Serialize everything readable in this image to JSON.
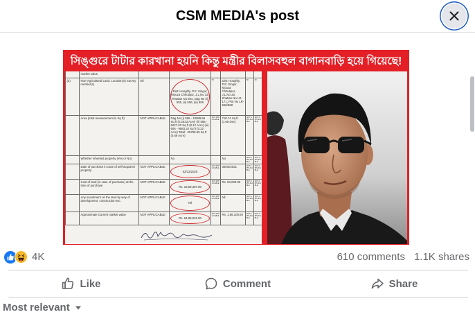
{
  "header": {
    "title": "CSM MEDIA's post"
  },
  "close_button": {
    "icon": "close-icon",
    "focus_ring_color": "#1a5bc4"
  },
  "post_image": {
    "headline": "সিঙ্গুরে টাটার কারখানা হয়নি কিন্তু মন্ত্রীর বিলাসবহুল বাগানবাড়ি হয়ে গিয়েছে!",
    "background_color": "#e41f26",
    "document": {
      "rows": [
        {
          "cells": [
            "",
            "market value",
            "",
            "",
            "",
            "",
            "",
            ""
          ]
        },
        {
          "cells": [
            "(a)",
            "Non-Agricultural Land: Location(s) Survey number(s)",
            "Nil",
            "Dist: Hooghly, P.S: Singur, Mouza Chhutipur, J.L.No 33, Khatian No 681, Dag No (i) 555, (ii) 556, (iii) 606",
            "Nil",
            "Dist: Hooghly, P.S: Singur, Mouza Chhutipur, J.L.No 33, Khatian No LR-171, Plot No LR-566/568",
            "Nil",
            "Nil"
          ],
          "circled": [
            3
          ]
        },
        {
          "cells": [
            "",
            "Area (total measurement in Sq ft)",
            "NOT APPLICABLE",
            "Dag No (i) 555 - 10989.59 Sq ft (0.2523 Acre) (ii) 556 - 5227.20 Sq ft (0.12 Acre) (iii) 606 - 9583.20 Sq ft (0.22 Acre) Total : 25799.99 Sq ft (0.59 Acre)",
            "NOT APPLICABLE",
            "718.74 Sq ft (1.65 Dec)",
            "NOT APPLICABLE",
            "NOT APPLICABLE"
          ]
        },
        {
          "cells": [
            "",
            "Whether inherited property (Yes or No)",
            "",
            "No",
            "",
            "No",
            "NOT APPLICABLE",
            "NOT APPLICABLE"
          ]
        },
        {
          "cells": [
            "",
            "Date of purchase in case of self-acquired property",
            "NOT APPLICABLE",
            "02/12/2020",
            "NOT APPLICABLE",
            "30/03/2021",
            "NOT APPLICABLE",
            "NOT APPLICABLE"
          ],
          "circled": [
            3
          ]
        },
        {
          "cells": [
            "",
            "Cost of land (in case of purchase) at the time of purchase",
            "NOT APPLICABLE",
            "Rs. 18,69,307.00",
            "NOT APPLICABLE",
            "Rs. 50,000.00",
            "NOT APPLICABLE",
            "NOT APPLICABLE"
          ],
          "circled": [
            3
          ]
        },
        {
          "cells": [
            "",
            "Any investment on the land by way of development, construction etc.",
            "NOT APPLICABLE",
            "Nil",
            "NOT APPLICABLE",
            "Nil",
            "NOT APPLICABLE",
            "NOT APPLICABLE"
          ],
          "circled": [
            3
          ]
        },
        {
          "cells": [
            "",
            "Approximate Current market value",
            "NOT APPLICABLE",
            "Rs. 64,85,031.00",
            "NOT APPLICABLE",
            "Rs. 1,86,100.00",
            "NOT APPLICABLE",
            "NOT APPLICABLE"
          ],
          "circled": [
            3
          ]
        }
      ],
      "signature": "handwritten-signature"
    },
    "photo": "portrait-man-in-sunglasses"
  },
  "stats": {
    "reactions": [
      "like-reaction-icon",
      "haha-reaction-icon"
    ],
    "reaction_count": "4K",
    "comments": "610 comments",
    "shares": "1.1K shares"
  },
  "actions": [
    {
      "label": "Like",
      "icon": "thumbs-up-icon"
    },
    {
      "label": "Comment",
      "icon": "comment-icon"
    },
    {
      "label": "Share",
      "icon": "share-icon"
    }
  ],
  "comments_filter": {
    "label": "Most relevant",
    "icon": "caret-down-icon"
  },
  "colors": {
    "accent": "#1877f2",
    "secondary_text": "#65676b",
    "divider": "#ced0d4",
    "headline_background": "#e41f26",
    "annotation_red": "#cf2a2f"
  }
}
